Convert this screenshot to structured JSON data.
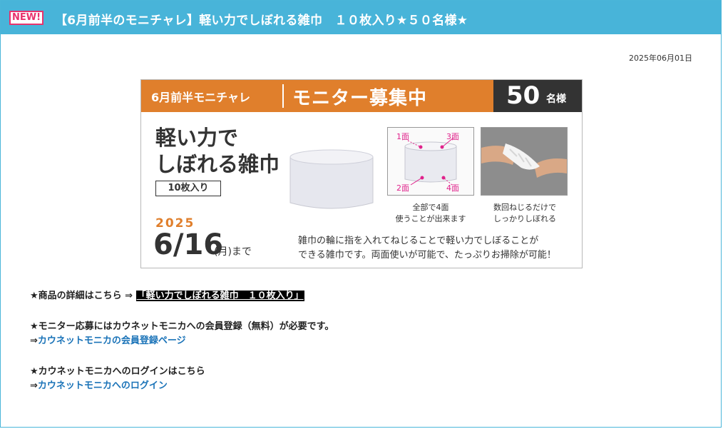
{
  "header": {
    "badge": "NEW!",
    "title": "【6月前半のモニチャレ】軽い力でしぼれる雑巾　１０枚入り★５０名様★"
  },
  "date": "2025年06月01日",
  "banner": {
    "left_label": "6月前半モニチャレ",
    "main_label": "モニター募集中",
    "count": "50",
    "count_unit": "名様",
    "product_line1": "軽い力で",
    "product_line2": "しぼれる雑巾",
    "quantity": "10枚入り",
    "year": "2025",
    "end_date": "6/16",
    "end_suffix": "(月)まで",
    "faces": [
      "1面",
      "3面",
      "2面",
      "4面"
    ],
    "diagram_caption1": "全部で4面",
    "diagram_caption2": "使うことが出来ます",
    "photo_caption1": "数回ねじるだけで",
    "photo_caption2": "しっかりしぼれる",
    "desc1": "雑巾の輪に指を入れてねじることで軽い力でしぼることが",
    "desc2": "できる雑巾です。両面使いが可能で、たっぷりお掃除が可能！"
  },
  "body": {
    "detail_prefix": "★商品の詳細はこちら ⇒",
    "detail_link": "「軽い力でしぼれる雑巾　１０枚入り」",
    "register_note": "★モニター応募にはカウネットモニカへの会員登録（無料）が必要です。",
    "register_arrow": "⇒",
    "register_link": "カウネットモニカの会員登録ページ",
    "login_note": "★カウネットモニカへのログインはこちら",
    "login_arrow": "⇒",
    "login_link": "カウネットモニカへのログイン"
  }
}
